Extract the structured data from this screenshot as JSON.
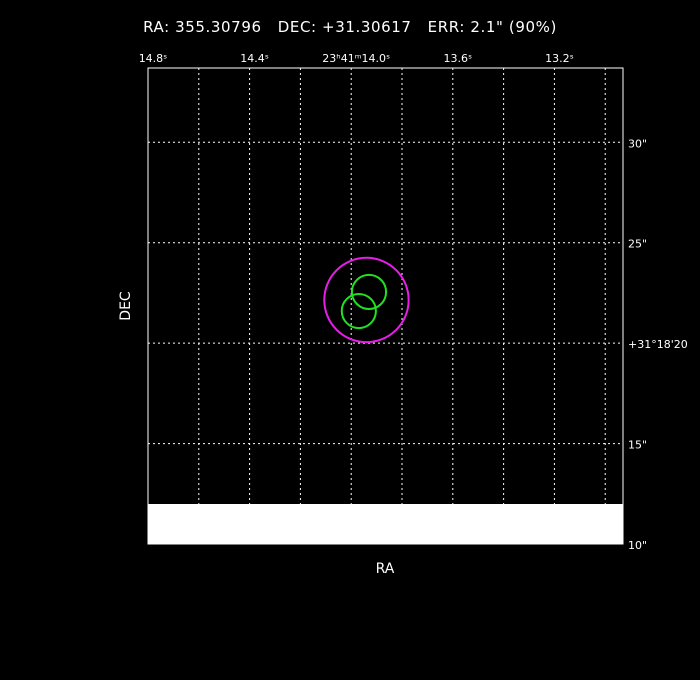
{
  "header": {
    "title": "RA: 355.30796   DEC: +31.30617   ERR: 2.1\" (90%)"
  },
  "chart_data": {
    "type": "scatter",
    "xlabel": "RA",
    "ylabel": "DEC",
    "x_ticks": [
      {
        "value": 14.8,
        "label": "14.8ˢ"
      },
      {
        "value": 14.4,
        "label": "14.4ˢ"
      },
      {
        "value": 14.0,
        "label": "23ʰ41ᵐ14.0ˢ"
      },
      {
        "value": 13.6,
        "label": "13.6ˢ"
      },
      {
        "value": 13.2,
        "label": "13.2ˢ"
      }
    ],
    "y_ticks": [
      {
        "value": 30,
        "label": "30\""
      },
      {
        "value": 25,
        "label": "25\""
      },
      {
        "value": 20,
        "label": "+31°18'20"
      },
      {
        "value": 15,
        "label": "15\""
      },
      {
        "value": 10,
        "label": "10\""
      }
    ],
    "xlim": [
      14.8,
      12.93
    ],
    "ylim": [
      10,
      33.7
    ],
    "grid": true,
    "circles": [
      {
        "ra": 13.94,
        "dec": 22.15,
        "radius_arcsec": 2.1,
        "color": "#e81ee8"
      },
      {
        "ra": 13.93,
        "dec": 22.55,
        "radius_arcsec": 0.85,
        "color": "#22e022"
      },
      {
        "ra": 13.97,
        "dec": 21.6,
        "radius_arcsec": 0.85,
        "color": "#22e022"
      }
    ]
  }
}
